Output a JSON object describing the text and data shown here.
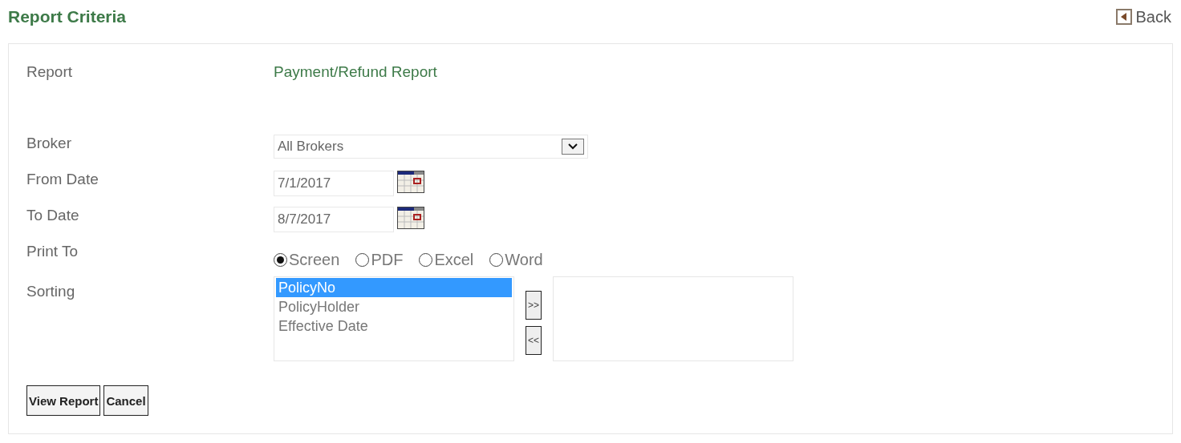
{
  "header": {
    "title": "Report Criteria",
    "back": "Back"
  },
  "report": {
    "label": "Report",
    "value": "Payment/Refund Report"
  },
  "broker": {
    "label": "Broker",
    "value": "All Brokers"
  },
  "from_date": {
    "label": "From Date",
    "value": "7/1/2017"
  },
  "to_date": {
    "label": "To Date",
    "value": "8/7/2017"
  },
  "print_to": {
    "label": "Print To",
    "options": [
      {
        "label": "Screen",
        "selected": true
      },
      {
        "label": "PDF",
        "selected": false
      },
      {
        "label": "Excel",
        "selected": false
      },
      {
        "label": "Word",
        "selected": false
      }
    ]
  },
  "sorting": {
    "label": "Sorting",
    "available": [
      {
        "label": "PolicyNo",
        "selected": true
      },
      {
        "label": "PolicyHolder",
        "selected": false
      },
      {
        "label": "Effective Date",
        "selected": false
      }
    ],
    "add_button": ">>",
    "remove_button": "<<"
  },
  "buttons": [
    "View Report",
    "Cancel"
  ]
}
